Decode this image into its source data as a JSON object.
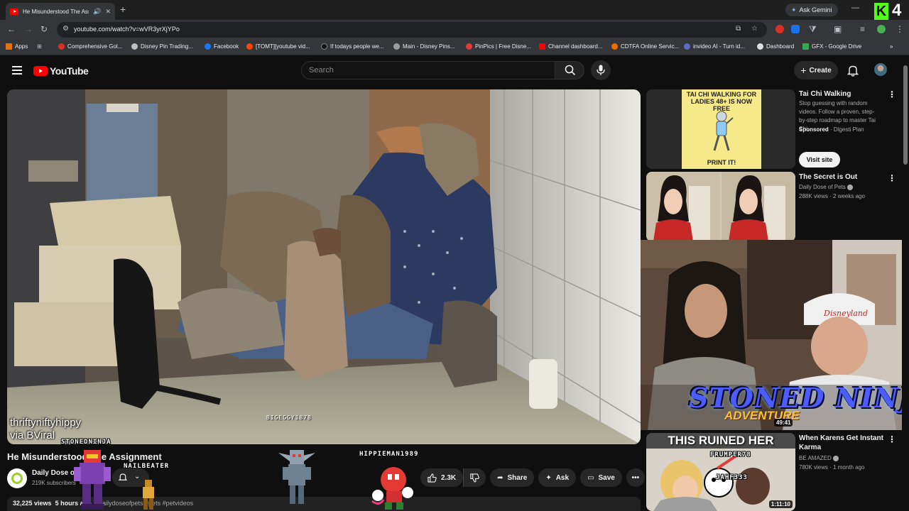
{
  "browser": {
    "tab_title": "He Misunderstood The Assignment",
    "new_tab": "+",
    "gemini_label": "Ask Gemini",
    "url": "youtube.com/watch?v=wVR3yrXjYPo",
    "kick_logo": "K",
    "kick_count": "4",
    "bookmarks": [
      "Apps",
      "Comprehensive Gol...",
      "Disney Pin Trading...",
      "Facebook",
      "[TOMT][youtube vid...",
      "If todays people we...",
      "Main - Disney Pins...",
      "PinPics | Free Disne...",
      "Channel dashboard...",
      "CDTFA Online Servic...",
      "invideo AI - Turn id...",
      "Dashboard",
      "GFX - Google Drive"
    ]
  },
  "youtube": {
    "logo_text": "YouTube",
    "search_placeholder": "Search",
    "create_label": "Create"
  },
  "video": {
    "credit_line1": "thriftyniftyhippy",
    "credit_line2": "via BViral",
    "watermark": "BIGEGGY1878",
    "title": "He Misunderstood The Assignment",
    "channel": "Daily Dose of Pets",
    "subscribers": "219K subscribers",
    "likes": "2.3K",
    "share": "Share",
    "ask": "Ask",
    "save": "Save",
    "views": "32,225 views",
    "age": "5 hours ago",
    "tags": "#dailydoseofpets #pets #petvideos"
  },
  "overlays": {
    "names": [
      "STONEDNINJA",
      "NAILBEATER",
      "HIPPIEMAN1989",
      "FRUMPER78",
      "JAHF333"
    ],
    "banner": "STONED NINJA",
    "banner_sub": "ADVENTURE",
    "timer": "49:41"
  },
  "sidebar": {
    "ad": {
      "image_text": "TAI CHI WALKING FOR LADIES 48+ IS NOW FREE",
      "image_footer": "PRINT IT!",
      "title": "Tai Chi Walking",
      "description": "Stop guessing with random videos. Follow a proven, step-by-step roadmap to master Tai Chi.",
      "sponsored": "Sponsored",
      "advertiser": "· Digesti Plan",
      "cta": "Visit site"
    },
    "videos": [
      {
        "title": "The Secret is Out",
        "channel": "Daily Dose of Pets",
        "meta": "288K views · 2 weeks ago"
      },
      {
        "title": "When Karens Get Instant Karma",
        "channel": "BE AMAZED",
        "meta": "780K views · 1 month ago",
        "thumb_text": "THIS RUINED HER",
        "duration": "1:11:10"
      }
    ]
  },
  "colors": {
    "brand_red": "#ff0000",
    "kick_green": "#53fc18",
    "banner_blue": "#4d5cff"
  },
  "icons": [
    "youtube-favicon",
    "speaker-icon",
    "close-icon",
    "back-icon",
    "forward-icon",
    "reload-icon",
    "site-info-icon",
    "install-icon",
    "star-icon",
    "extensions-icon",
    "menu-icon",
    "search-icon",
    "mic-icon",
    "bell-icon",
    "thumbs-up-icon",
    "thumbs-down-icon",
    "share-icon",
    "sparkle-icon",
    "save-icon",
    "more-icon"
  ]
}
